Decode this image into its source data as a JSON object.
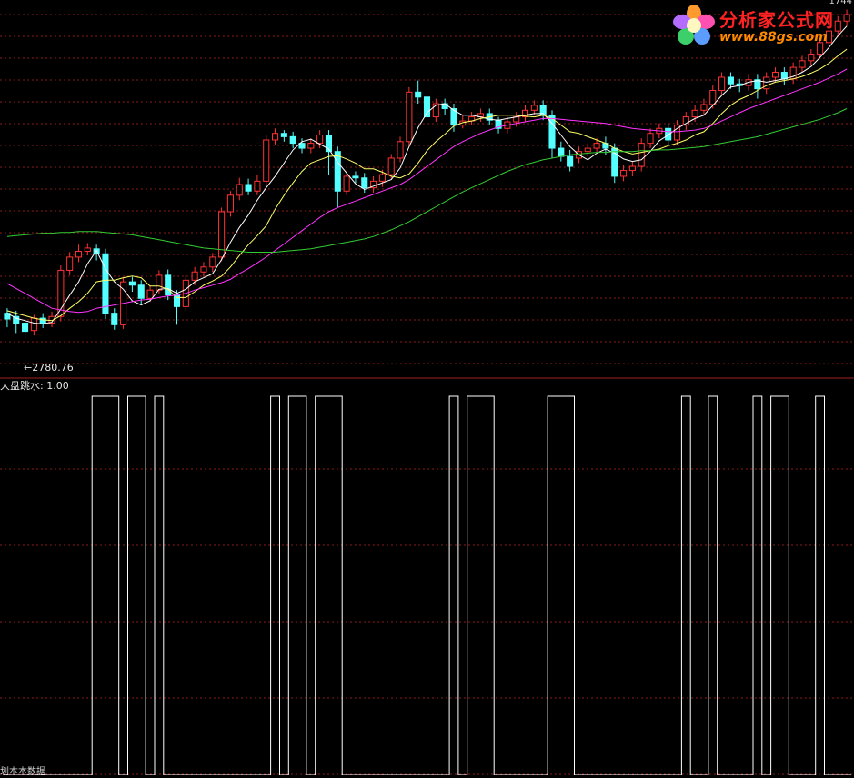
{
  "labels": {
    "low_marker": "←2780.76",
    "indicator_name": "大盘跳水",
    "indicator_value": ": 1.00",
    "bottom_left": "划本本数据",
    "top_right": "1744"
  },
  "logo": {
    "title": "分析家公式网",
    "url": "www.88gs.com"
  },
  "colors": {
    "up_candle": "#ff3232",
    "down_candle": "#54ffff",
    "ma5": "#ffffff",
    "ma10": "#ffff66",
    "ma20": "#ff33ff",
    "ma60": "#33cc33",
    "grid": "#8b1a1a",
    "divider": "#a02020",
    "signal": "#ffffff"
  },
  "chart_data": [
    {
      "type": "candlestick",
      "title": "",
      "price_range": [
        2740,
        3185
      ],
      "annotations": [
        {
          "text": "←2780.76",
          "value": 2780.76
        }
      ],
      "candles": [
        [
          2812,
          2805,
          2818,
          2795
        ],
        [
          2808,
          2799,
          2815,
          2788
        ],
        [
          2800,
          2790,
          2806,
          2781
        ],
        [
          2791,
          2806,
          2810,
          2785
        ],
        [
          2806,
          2800,
          2812,
          2794
        ],
        [
          2800,
          2808,
          2814,
          2795
        ],
        [
          2808,
          2864,
          2870,
          2802
        ],
        [
          2864,
          2880,
          2886,
          2858
        ],
        [
          2880,
          2887,
          2895,
          2874
        ],
        [
          2887,
          2891,
          2897,
          2882
        ],
        [
          2890,
          2884,
          2895,
          2876
        ],
        [
          2884,
          2812,
          2890,
          2805
        ],
        [
          2812,
          2798,
          2818,
          2792
        ],
        [
          2798,
          2850,
          2855,
          2793
        ],
        [
          2850,
          2846,
          2856,
          2838
        ],
        [
          2846,
          2830,
          2852,
          2822
        ],
        [
          2830,
          2840,
          2845,
          2826
        ],
        [
          2840,
          2858,
          2864,
          2835
        ],
        [
          2858,
          2834,
          2865,
          2828
        ],
        [
          2834,
          2820,
          2840,
          2798
        ],
        [
          2820,
          2852,
          2858,
          2815
        ],
        [
          2852,
          2862,
          2868,
          2846
        ],
        [
          2862,
          2868,
          2874,
          2856
        ],
        [
          2868,
          2880,
          2885,
          2862
        ],
        [
          2880,
          2935,
          2940,
          2875
        ],
        [
          2935,
          2955,
          2960,
          2929
        ],
        [
          2955,
          2968,
          2976,
          2949
        ],
        [
          2968,
          2960,
          2975,
          2955
        ],
        [
          2960,
          2972,
          2980,
          2955
        ],
        [
          2972,
          3022,
          3028,
          2967
        ],
        [
          3022,
          3030,
          3036,
          3016
        ],
        [
          3030,
          3026,
          3034,
          3020
        ],
        [
          3026,
          3018,
          3032,
          3012
        ],
        [
          3018,
          3012,
          3024,
          3006
        ],
        [
          3012,
          3018,
          3024,
          3006
        ],
        [
          3018,
          3028,
          3034,
          3012
        ],
        [
          3028,
          3008,
          3034,
          2980
        ],
        [
          3008,
          2960,
          3014,
          2940
        ],
        [
          2960,
          2978,
          2984,
          2955
        ],
        [
          2978,
          2976,
          2984,
          2970
        ],
        [
          2976,
          2964,
          2982,
          2958
        ],
        [
          2964,
          2972,
          2978,
          2958
        ],
        [
          2972,
          2980,
          2986,
          2965
        ],
        [
          2980,
          3000,
          3005,
          2975
        ],
        [
          3000,
          3020,
          3026,
          2995
        ],
        [
          3020,
          3080,
          3086,
          3015
        ],
        [
          3080,
          3074,
          3094,
          3066
        ],
        [
          3074,
          3050,
          3080,
          3044
        ],
        [
          3050,
          3066,
          3072,
          3044
        ],
        [
          3066,
          3060,
          3072,
          3052
        ],
        [
          3060,
          3040,
          3066,
          3032
        ],
        [
          3040,
          3045,
          3052,
          3036
        ],
        [
          3045,
          3050,
          3056,
          3040
        ],
        [
          3050,
          3054,
          3060,
          3044
        ],
        [
          3054,
          3046,
          3060,
          3040
        ],
        [
          3046,
          3036,
          3050,
          3030
        ],
        [
          3036,
          3044,
          3050,
          3030
        ],
        [
          3044,
          3050,
          3056,
          3038
        ],
        [
          3050,
          3058,
          3064,
          3044
        ],
        [
          3058,
          3064,
          3070,
          3052
        ],
        [
          3064,
          3052,
          3070,
          3046
        ],
        [
          3052,
          3012,
          3058,
          3000
        ],
        [
          3012,
          3002,
          3020,
          2996
        ],
        [
          3002,
          2990,
          3010,
          2984
        ],
        [
          3000,
          3008,
          3014,
          2994
        ],
        [
          3008,
          3012,
          3018,
          3002
        ],
        [
          3012,
          3018,
          3024,
          3006
        ],
        [
          3018,
          3012,
          3026,
          3004
        ],
        [
          3012,
          2978,
          3018,
          2970
        ],
        [
          2978,
          2985,
          2992,
          2972
        ],
        [
          2985,
          2990,
          2996,
          2978
        ],
        [
          2990,
          3018,
          3024,
          2984
        ],
        [
          3018,
          3030,
          3036,
          3012
        ],
        [
          3030,
          3036,
          3042,
          3024
        ],
        [
          3036,
          3022,
          3042,
          3016
        ],
        [
          3022,
          3040,
          3046,
          3016
        ],
        [
          3040,
          3050,
          3056,
          3034
        ],
        [
          3050,
          3058,
          3064,
          3044
        ],
        [
          3058,
          3065,
          3072,
          3052
        ],
        [
          3065,
          3082,
          3088,
          3060
        ],
        [
          3082,
          3098,
          3104,
          3076
        ],
        [
          3098,
          3090,
          3104,
          3084
        ],
        [
          3090,
          3088,
          3096,
          3080
        ],
        [
          3088,
          3095,
          3102,
          3082
        ],
        [
          3095,
          3084,
          3102,
          3072
        ],
        [
          3084,
          3098,
          3104,
          3078
        ],
        [
          3098,
          3104,
          3110,
          3092
        ],
        [
          3104,
          3096,
          3110,
          3088
        ],
        [
          3096,
          3110,
          3116,
          3090
        ],
        [
          3110,
          3118,
          3124,
          3104
        ],
        [
          3118,
          3126,
          3132,
          3112
        ],
        [
          3126,
          3140,
          3146,
          3120
        ],
        [
          3140,
          3154,
          3160,
          3134
        ],
        [
          3154,
          3166,
          3172,
          3148
        ],
        [
          3166,
          3174,
          3180,
          3160
        ]
      ],
      "series": [
        {
          "name": "MA5",
          "values": [
            2812,
            2806,
            2803,
            2800,
            2799,
            2801,
            2817,
            2834,
            2850,
            2872,
            2888,
            2866,
            2850,
            2841,
            2827,
            2822,
            2827,
            2841,
            2842,
            2836,
            2841,
            2850,
            2855,
            2860,
            2877,
            2898,
            2916,
            2931,
            2949,
            2964,
            2978,
            2994,
            3010,
            3020,
            3023,
            3017,
            3011,
            2995,
            2982,
            2969,
            2962,
            2966,
            2970,
            2974,
            2988,
            3014,
            3037,
            3055,
            3064,
            3066,
            3058,
            3052,
            3052,
            3050,
            3047,
            3046,
            3048,
            3050,
            3052,
            3054,
            3054,
            3042,
            3028,
            3014,
            3004,
            2998,
            3006,
            3011,
            3006,
            2999,
            2996,
            2998,
            3008,
            3021,
            3028,
            3036,
            3042,
            3048,
            3052,
            3064,
            3076,
            3086,
            3088,
            3092,
            3094,
            3092,
            3094,
            3096,
            3099,
            3104,
            3111,
            3122,
            3134,
            3148,
            3160
          ]
        },
        {
          "name": "MA10",
          "values": [
            2815,
            2812,
            2809,
            2806,
            2804,
            2803,
            2809,
            2818,
            2826,
            2836,
            2850,
            2852,
            2852,
            2855,
            2857,
            2855,
            2845,
            2845,
            2841,
            2831,
            2831,
            2838,
            2846,
            2851,
            2857,
            2868,
            2882,
            2895,
            2906,
            2918,
            2938,
            2955,
            2970,
            2984,
            2994,
            2998,
            3002,
            3003,
            2999,
            2994,
            2987,
            2987,
            2983,
            2978,
            2976,
            2981,
            2994,
            3009,
            3020,
            3029,
            3039,
            3043,
            3045,
            3048,
            3050,
            3052,
            3052,
            3052,
            3051,
            3050,
            3052,
            3048,
            3040,
            3032,
            3030,
            3026,
            3022,
            3018,
            3012,
            3008,
            3005,
            3007,
            3009,
            3011,
            3015,
            3018,
            3022,
            3028,
            3032,
            3042,
            3054,
            3064,
            3071,
            3076,
            3082,
            3088,
            3092,
            3094,
            3096,
            3099,
            3103,
            3108,
            3115,
            3124,
            3132
          ]
        },
        {
          "name": "MA20",
          "values": [
            2848,
            2842,
            2836,
            2830,
            2824,
            2818,
            2816,
            2814,
            2813,
            2814,
            2818,
            2820,
            2822,
            2824,
            2826,
            2828,
            2829,
            2831,
            2833,
            2834,
            2836,
            2840,
            2843,
            2846,
            2849,
            2853,
            2860,
            2866,
            2873,
            2880,
            2888,
            2896,
            2904,
            2912,
            2920,
            2928,
            2935,
            2940,
            2944,
            2948,
            2952,
            2956,
            2960,
            2964,
            2968,
            2974,
            2982,
            2990,
            2998,
            3006,
            3014,
            3020,
            3025,
            3030,
            3034,
            3038,
            3040,
            3042,
            3044,
            3046,
            3048,
            3048,
            3047,
            3046,
            3045,
            3044,
            3043,
            3042,
            3040,
            3038,
            3036,
            3035,
            3034,
            3033,
            3032,
            3032,
            3033,
            3034,
            3036,
            3040,
            3045,
            3050,
            3055,
            3060,
            3064,
            3068,
            3072,
            3076,
            3080,
            3084,
            3088,
            3092,
            3097,
            3102,
            3108
          ]
        },
        {
          "name": "MA60",
          "values": [
            2905,
            2906,
            2907,
            2908,
            2909,
            2909,
            2910,
            2910,
            2911,
            2911,
            2911,
            2910,
            2909,
            2908,
            2907,
            2905,
            2903,
            2901,
            2899,
            2897,
            2895,
            2893,
            2891,
            2890,
            2889,
            2888,
            2887,
            2886,
            2886,
            2886,
            2886,
            2887,
            2888,
            2889,
            2890,
            2892,
            2894,
            2896,
            2898,
            2900,
            2902,
            2905,
            2909,
            2913,
            2918,
            2923,
            2929,
            2935,
            2941,
            2947,
            2953,
            2959,
            2964,
            2969,
            2974,
            2979,
            2984,
            2988,
            2992,
            2995,
            2998,
            3000,
            3002,
            3004,
            3005,
            3006,
            3007,
            3007,
            3008,
            3008,
            3008,
            3009,
            3009,
            3010,
            3010,
            3011,
            3012,
            3013,
            3014,
            3016,
            3018,
            3020,
            3022,
            3024,
            3026,
            3029,
            3032,
            3035,
            3038,
            3041,
            3044,
            3047,
            3051,
            3055,
            3060
          ]
        }
      ]
    },
    {
      "type": "line",
      "title": "大盘跳水",
      "ylim": [
        0,
        1
      ],
      "series": [
        {
          "name": "大盘跳水",
          "values": [
            0,
            0,
            0,
            0,
            0,
            0,
            0,
            0,
            0,
            0,
            1,
            1,
            1,
            0,
            1,
            1,
            0,
            1,
            0,
            0,
            0,
            0,
            0,
            0,
            0,
            0,
            0,
            0,
            0,
            0,
            1,
            0,
            1,
            1,
            0,
            1,
            1,
            1,
            0,
            0,
            0,
            0,
            0,
            0,
            0,
            0,
            0,
            0,
            0,
            0,
            1,
            0,
            1,
            1,
            1,
            0,
            0,
            0,
            0,
            0,
            0,
            1,
            1,
            1,
            0,
            0,
            0,
            0,
            0,
            0,
            0,
            0,
            0,
            0,
            0,
            0,
            1,
            0,
            0,
            1,
            0,
            0,
            0,
            0,
            1,
            0,
            1,
            1,
            0,
            0,
            0,
            1,
            0,
            0,
            0
          ]
        }
      ]
    }
  ]
}
